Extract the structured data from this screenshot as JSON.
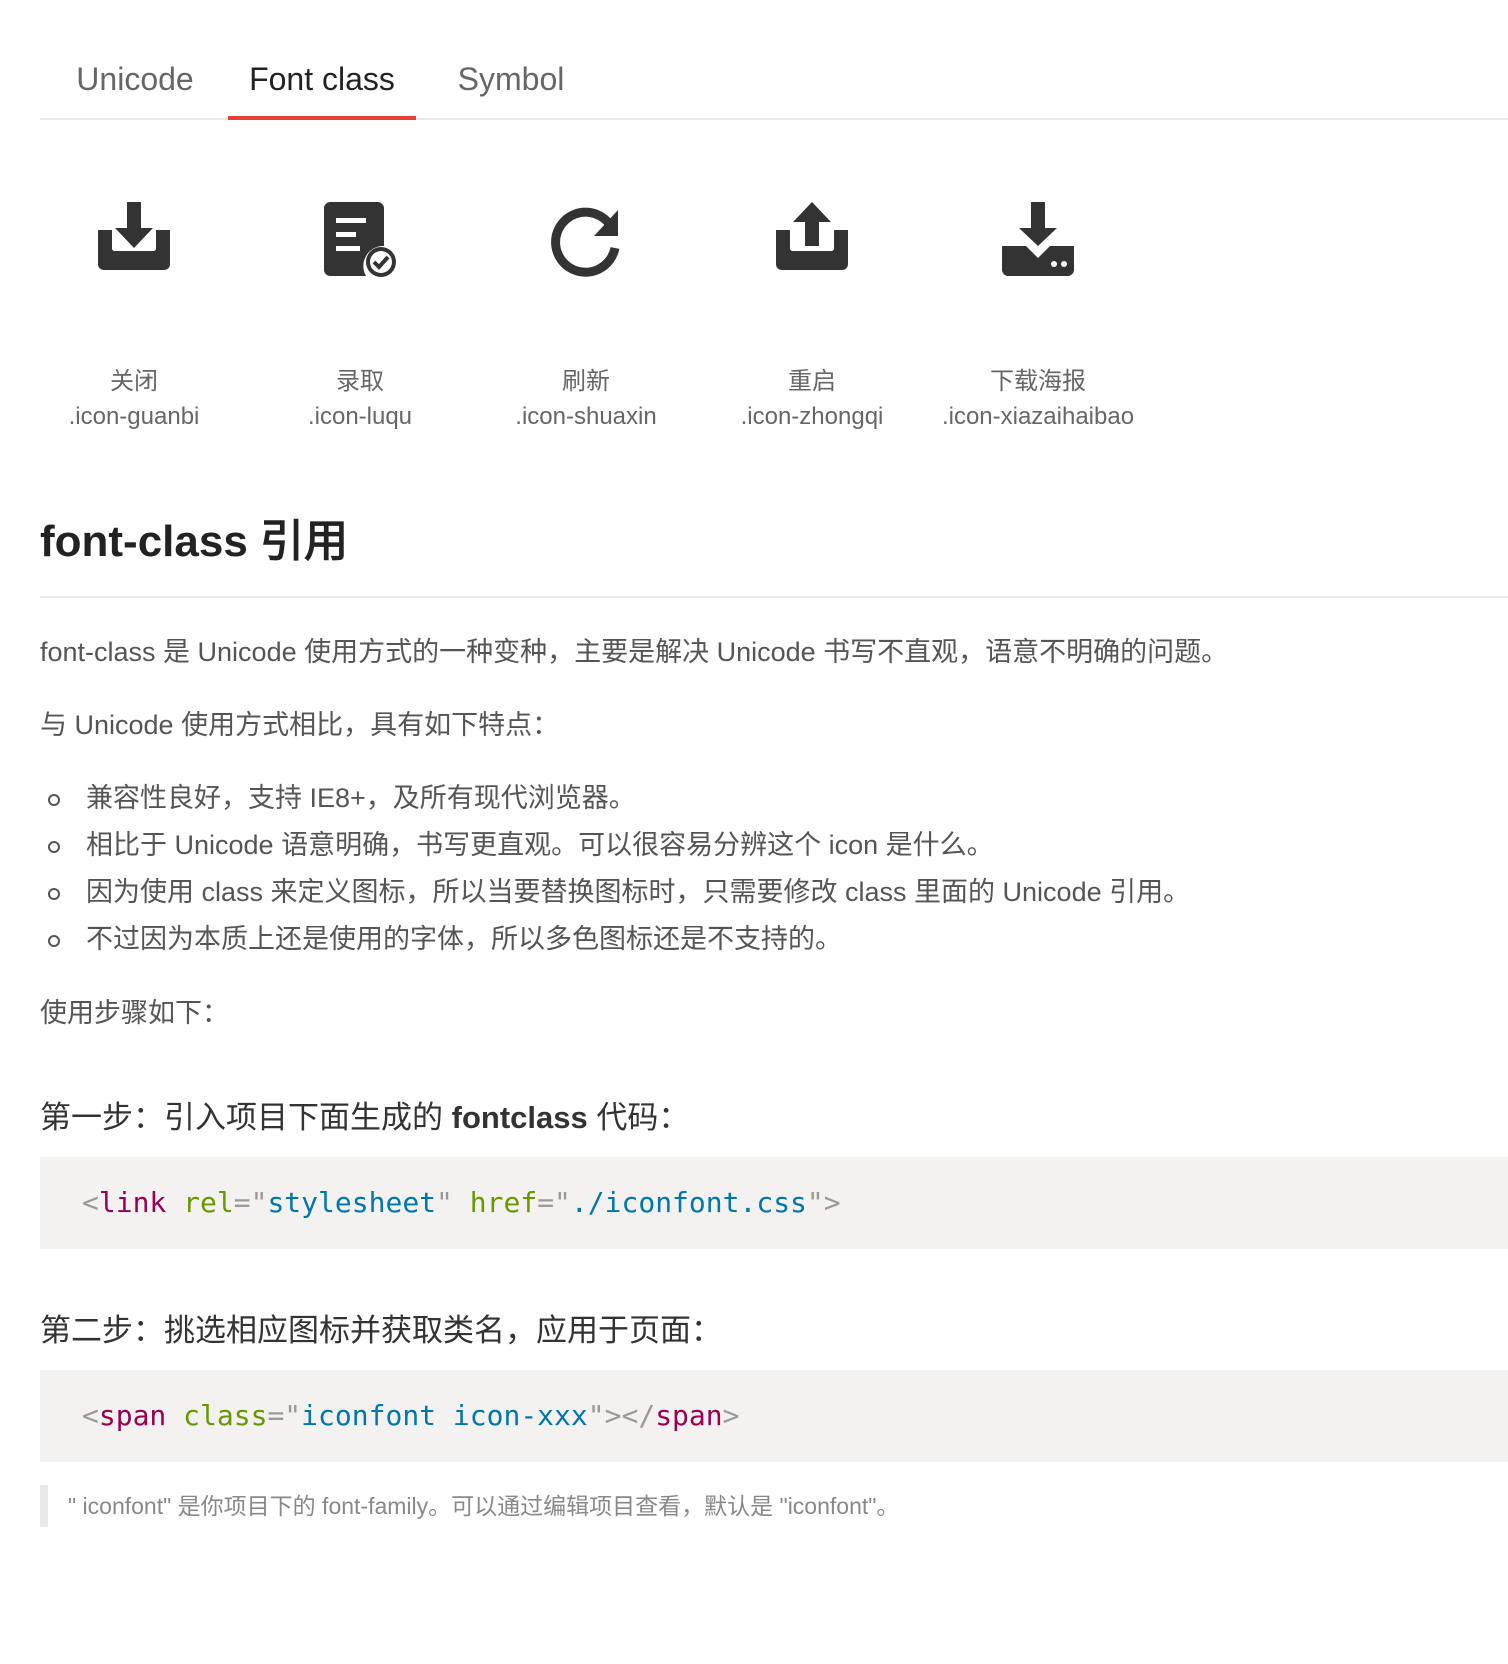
{
  "tabs": [
    {
      "label": "Unicode",
      "active": false
    },
    {
      "label": "Font class",
      "active": true
    },
    {
      "label": "Symbol",
      "active": false
    }
  ],
  "icons": [
    {
      "name": "关闭",
      "class": ".icon-guanbi",
      "glyph": "inbox-download-icon"
    },
    {
      "name": "录取",
      "class": ".icon-luqu",
      "glyph": "document-check-icon"
    },
    {
      "name": "刷新",
      "class": ".icon-shuaxin",
      "glyph": "refresh-icon"
    },
    {
      "name": "重启",
      "class": ".icon-zhongqi",
      "glyph": "inbox-upload-icon"
    },
    {
      "name": "下载海报",
      "class": ".icon-xiazaihaibao",
      "glyph": "download-drive-icon"
    }
  ],
  "section": {
    "title": "font-class 引用",
    "intro": "font-class 是 Unicode 使用方式的一种变种，主要是解决 Unicode 书写不直观，语意不明确的问题。",
    "compare": "与 Unicode 使用方式相比，具有如下特点：",
    "features": [
      "兼容性良好，支持 IE8+，及所有现代浏览器。",
      "相比于 Unicode 语意明确，书写更直观。可以很容易分辨这个 icon 是什么。",
      "因为使用 class 来定义图标，所以当要替换图标时，只需要修改 class 里面的 Unicode 引用。",
      "不过因为本质上还是使用的字体，所以多色图标还是不支持的。"
    ],
    "steps_intro": "使用步骤如下：",
    "step1": {
      "prefix": "第一步：引入项目下面生成的 ",
      "bold": "fontclass",
      "suffix": " 代码："
    },
    "code1": {
      "open": "<",
      "tag": "link",
      "attr1": "rel",
      "eq1": "=\"",
      "val1": "stylesheet",
      "q1": "\" ",
      "attr2": "href",
      "eq2": "=\"",
      "val2": "./iconfont.css",
      "close": "\">"
    },
    "step2": "第二步：挑选相应图标并获取类名，应用于页面：",
    "code2": {
      "open": "<",
      "tag": "span",
      "attr": "class",
      "eq": "=\"",
      "val": "iconfont icon-xxx",
      "mid": "\"></",
      "endtag": "span",
      "close": ">"
    },
    "note": "\" iconfont\" 是你项目下的 font-family。可以通过编辑项目查看，默认是 \"iconfont\"。"
  },
  "colors": {
    "accent": "#e9403a",
    "icon": "#333333",
    "code_bg": "#f4f2f0"
  }
}
